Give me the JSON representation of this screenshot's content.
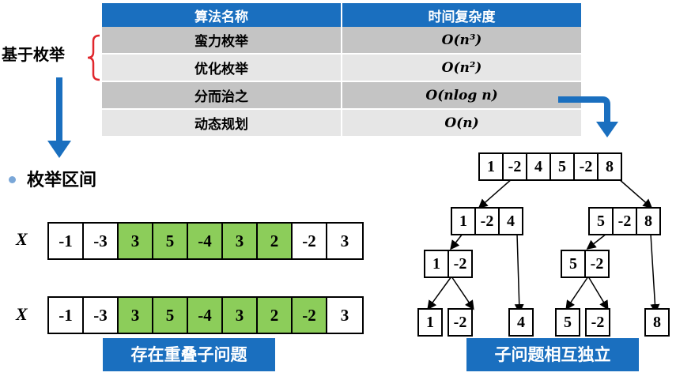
{
  "table": {
    "headers": [
      "算法名称",
      "时间复杂度"
    ],
    "rows": [
      {
        "name": "蛮力枚举",
        "complexity": "O(n³)"
      },
      {
        "name": "优化枚举",
        "complexity": "O(n²)"
      },
      {
        "name": "分而治之",
        "complexity": "O(nlog n)"
      },
      {
        "name": "动态规划",
        "complexity": "O(n)"
      }
    ]
  },
  "left_label": "基于枚举",
  "section_title": "枚举区间",
  "arrays": {
    "x_label": "X",
    "row1": [
      "-1",
      "-3",
      "3",
      "5",
      "-4",
      "3",
      "2",
      "-2",
      "3"
    ],
    "row2": [
      "-1",
      "-3",
      "3",
      "5",
      "-4",
      "3",
      "2",
      "-2",
      "3"
    ]
  },
  "tree": {
    "root": [
      "1",
      "-2",
      "4",
      "5",
      "-2",
      "8"
    ],
    "left": [
      "1",
      "-2",
      "4"
    ],
    "right": [
      "5",
      "-2",
      "8"
    ],
    "left_left": [
      "1",
      "-2"
    ],
    "right_left": [
      "5",
      "-2"
    ],
    "leaves": [
      "1",
      "-2",
      "4",
      "5",
      "-2",
      "8"
    ]
  },
  "badges": {
    "left": "存在重叠子问题",
    "right": "子问题相互独立"
  },
  "colors": {
    "accent_blue": "#1a6fbf",
    "highlight_green": "#8ccd5a",
    "brace_red": "#e0262c"
  }
}
